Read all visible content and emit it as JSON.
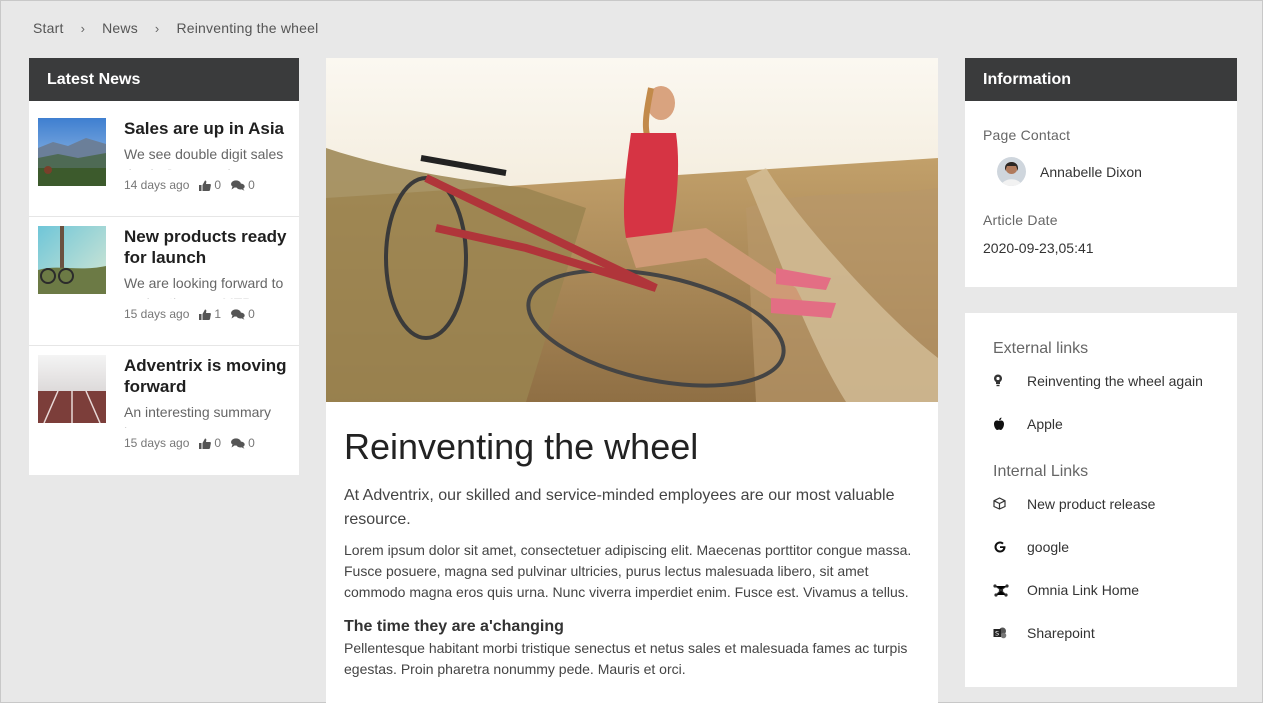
{
  "breadcrumb": {
    "items": [
      "Start",
      "News",
      "Reinventing the wheel"
    ],
    "separator": "›"
  },
  "latest_news": {
    "title": "Latest News",
    "items": [
      {
        "title": "Sales are up in Asia",
        "summary": "We see double digit sales rise in Japan and",
        "age": "14 days ago",
        "likes": "0",
        "comments": "0"
      },
      {
        "title": "New products ready for launch",
        "summary": "We are looking forward to seeing the new MTB",
        "age": "15 days ago",
        "likes": "1",
        "comments": "0"
      },
      {
        "title": "Adventrix is moving forward",
        "summary": "An interesting summary here",
        "age": "15 days ago",
        "likes": "0",
        "comments": "0"
      }
    ]
  },
  "article": {
    "title": "Reinventing the wheel",
    "lead": "At Adventrix, our skilled and service-minded employees are our most valuable resource.",
    "paragraph1": "Lorem ipsum dolor sit amet, consectetuer adipiscing elit. Maecenas porttitor congue massa. Fusce posuere, magna sed pulvinar ultricies, purus lectus malesuada libero, sit amet commodo magna eros quis urna. Nunc viverra imperdiet enim. Fusce est. Vivamus a tellus.",
    "subheading": "The time they are a'changing",
    "paragraph2": "Pellentesque habitant morbi tristique senectus et netus sales et malesuada fames ac turpis egestas. Proin pharetra nonummy pede. Mauris et orci."
  },
  "information": {
    "title": "Information",
    "contact_label": "Page Contact",
    "contact_name": "Annabelle Dixon",
    "date_label": "Article Date",
    "date_value": "2020-09-23,05:41"
  },
  "links": {
    "external_heading": "External links",
    "external": [
      {
        "label": "Reinventing the wheel again",
        "icon": "lightbulb-icon"
      },
      {
        "label": "Apple",
        "icon": "apple-icon"
      }
    ],
    "internal_heading": "Internal Links",
    "internal": [
      {
        "label": "New product release",
        "icon": "box-icon"
      },
      {
        "label": "google",
        "icon": "google-icon"
      },
      {
        "label": "Omnia Link Home",
        "icon": "network-icon"
      },
      {
        "label": "Sharepoint",
        "icon": "sharepoint-icon"
      }
    ]
  },
  "colors": {
    "panel_header": "#3a3b3c",
    "page_bg": "#e8e8e8",
    "card_bg": "#ffffff"
  }
}
